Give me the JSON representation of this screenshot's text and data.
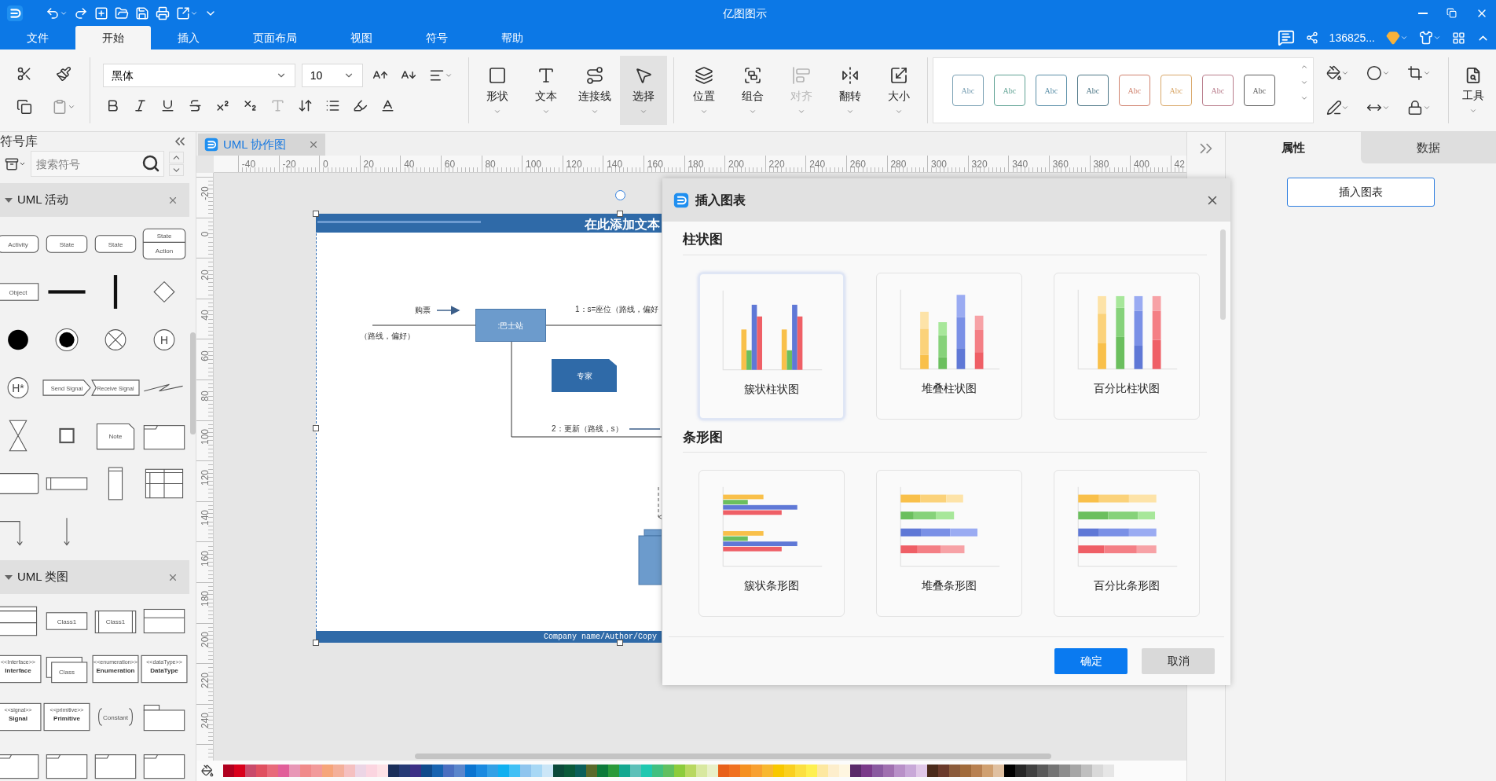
{
  "app": {
    "title": "亿图图示",
    "user": "136825..."
  },
  "menu": [
    {
      "label": "文件",
      "selected": false
    },
    {
      "label": "开始",
      "selected": true
    },
    {
      "label": "插入",
      "selected": false
    },
    {
      "label": "页面布局",
      "selected": false
    },
    {
      "label": "视图",
      "selected": false
    },
    {
      "label": "符号",
      "selected": false
    },
    {
      "label": "帮助",
      "selected": false
    }
  ],
  "ribbon": {
    "font": "黑体",
    "font_size": "10",
    "format_buttons": [
      {
        "kind": "bold",
        "disabled": false
      },
      {
        "kind": "italic",
        "disabled": false
      },
      {
        "kind": "underline",
        "disabled": false
      },
      {
        "kind": "strike",
        "disabled": false
      },
      {
        "kind": "superscript",
        "disabled": false
      },
      {
        "kind": "subscript",
        "disabled": false
      },
      {
        "kind": "text-style",
        "disabled": true
      },
      {
        "kind": "line-spacing",
        "disabled": false
      },
      {
        "kind": "list",
        "disabled": false
      },
      {
        "kind": "highlight",
        "disabled": false
      },
      {
        "kind": "font-color",
        "disabled": false
      }
    ],
    "tools": [
      {
        "kind": "shape",
        "label": "形状",
        "selected": false,
        "disabled": false
      },
      {
        "kind": "text",
        "label": "文本",
        "selected": false,
        "disabled": false
      },
      {
        "kind": "connector",
        "label": "连接线",
        "selected": false,
        "disabled": false
      },
      {
        "kind": "select",
        "label": "选择",
        "selected": true,
        "disabled": false
      },
      {
        "kind": "position",
        "label": "位置",
        "selected": false,
        "disabled": false
      },
      {
        "kind": "group",
        "label": "组合",
        "selected": false,
        "disabled": false
      },
      {
        "kind": "align",
        "label": "对齐",
        "selected": false,
        "disabled": true
      },
      {
        "kind": "flip",
        "label": "翻转",
        "selected": false,
        "disabled": false
      },
      {
        "kind": "size",
        "label": "大小",
        "selected": false,
        "disabled": false
      }
    ],
    "styles": [
      {
        "label": "Abc",
        "color": "#7aa0b4"
      },
      {
        "label": "Abc",
        "color": "#5fa293"
      },
      {
        "label": "Abc",
        "color": "#5a8fa8"
      },
      {
        "label": "Abc",
        "color": "#4f7888"
      },
      {
        "label": "Abc",
        "color": "#d0826e"
      },
      {
        "label": "Abc",
        "color": "#d9a86a"
      },
      {
        "label": "Abc",
        "color": "#b97d8c"
      },
      {
        "label": "Abc",
        "color": "#606060"
      }
    ],
    "tools_button": "工具"
  },
  "library": {
    "title": "符号库",
    "search": {
      "placeholder": "搜索符号"
    },
    "sections": [
      {
        "title": "UML 活动",
        "expanded": true,
        "shapes": [
          {
            "kind": "rounded",
            "label": "Activity"
          },
          {
            "kind": "rounded",
            "label": "State"
          },
          {
            "kind": "rounded",
            "label": "State"
          },
          {
            "kind": "state-action",
            "label": "State",
            "sublabel": "Action"
          },
          {
            "kind": "rect",
            "label": "Object"
          },
          {
            "kind": "hbar"
          },
          {
            "kind": "vbar"
          },
          {
            "kind": "diamond"
          },
          {
            "kind": "initial"
          },
          {
            "kind": "final"
          },
          {
            "kind": "flow-final"
          },
          {
            "kind": "history",
            "label": "H"
          },
          {
            "kind": "history",
            "label": "H*"
          },
          {
            "kind": "send",
            "label": "Send Signal"
          },
          {
            "kind": "receive",
            "label": "Receive Signal"
          },
          {
            "kind": "zigzag"
          },
          {
            "kind": "hourglass"
          },
          {
            "kind": "square"
          },
          {
            "kind": "note",
            "label": "Note"
          },
          {
            "kind": "frame"
          },
          {
            "kind": "rect-empty"
          },
          {
            "kind": "double-rect"
          },
          {
            "kind": "tall-rect"
          },
          {
            "kind": "grid"
          },
          {
            "kind": "elbow-arrow"
          },
          {
            "kind": "down-arrow"
          }
        ]
      },
      {
        "title": "UML 类图",
        "expanded": true,
        "shapes": [
          {
            "kind": "class-compartments"
          },
          {
            "kind": "rect",
            "label": "Class1"
          },
          {
            "kind": "class-bars",
            "label": "Class1"
          },
          {
            "kind": "interface-list"
          },
          {
            "kind": "stereotype",
            "label": "Interface",
            "sublabel": "<<Interface>>"
          },
          {
            "kind": "stacked",
            "label": "Class"
          },
          {
            "kind": "stereotype",
            "label": "Enumeration",
            "sublabel": "<<enumeration>>"
          },
          {
            "kind": "stereotype",
            "label": "DataType",
            "sublabel": "<<dataType>>"
          },
          {
            "kind": "stereotype",
            "label": "Signal",
            "sublabel": "<<signal>>"
          },
          {
            "kind": "stereotype",
            "label": "Primitive",
            "sublabel": "<<primitive>>"
          },
          {
            "kind": "constant",
            "label": "Constant"
          },
          {
            "kind": "package"
          },
          {
            "kind": "frame"
          },
          {
            "kind": "frame"
          },
          {
            "kind": "frame"
          },
          {
            "kind": "frame"
          }
        ]
      }
    ]
  },
  "document_tab": {
    "title": "UML 协作图"
  },
  "ruler": {
    "horizontal": [
      "-40",
      "-20",
      "0",
      "20",
      "40",
      "60",
      "80",
      "100",
      "120",
      "140",
      "160",
      "180",
      "200",
      "220",
      "240",
      "260",
      "280",
      "300",
      "320",
      "340",
      "360",
      "380",
      "400",
      "42"
    ],
    "vertical": [
      "-20",
      "0",
      "20",
      "40",
      "60",
      "80",
      "100",
      "120",
      "140",
      "160",
      "180",
      "200",
      "220",
      "240"
    ]
  },
  "diagram": {
    "header": "在此添加文本",
    "footer": "Company name/Author/Copy",
    "entry_label": "购票",
    "entry_params": "（路线，偏好）",
    "station": ":巴士站",
    "expert": "专家",
    "message_1": "1：s=座位（路线，偏好",
    "message_2": "2：更新（路线，s）"
  },
  "palette": [
    {
      "color": "#b0001e"
    },
    {
      "color": "#d9001b"
    },
    {
      "color": "#c94a6a"
    },
    {
      "color": "#e05060"
    },
    {
      "color": "#e86a7a"
    },
    {
      "color": "#e15f99"
    },
    {
      "color": "#e897b6"
    },
    {
      "color": "#f08a8a"
    },
    {
      "color": "#f29a9a"
    },
    {
      "color": "#f6a57a"
    },
    {
      "color": "#f4b09a"
    },
    {
      "color": "#f5c0c0"
    },
    {
      "color": "#ecd5e5"
    },
    {
      "color": "#fbd5e0"
    },
    {
      "color": "#fde2e6"
    },
    {
      "color": "#1a2f5a"
    },
    {
      "color": "#253a75"
    },
    {
      "color": "#3c2f85"
    },
    {
      "color": "#0f4a8c"
    },
    {
      "color": "#1763b0"
    },
    {
      "color": "#4a6fc0"
    },
    {
      "color": "#5a86cc"
    },
    {
      "color": "#0a74d0"
    },
    {
      "color": "#1a8ae0"
    },
    {
      "color": "#33a1e6"
    },
    {
      "color": "#10b0f0"
    },
    {
      "color": "#40c0f5"
    },
    {
      "color": "#8fc5ee"
    },
    {
      "color": "#a8d8f5"
    },
    {
      "color": "#cbe6f7"
    },
    {
      "color": "#0b4a3a"
    },
    {
      "color": "#0a5a3a"
    },
    {
      "color": "#0b5f5a"
    },
    {
      "color": "#5a6a2a"
    },
    {
      "color": "#0c7a3a"
    },
    {
      "color": "#2a9a3a"
    },
    {
      "color": "#14a890"
    },
    {
      "color": "#5cc0b8"
    },
    {
      "color": "#20c8b0"
    },
    {
      "color": "#40c080"
    },
    {
      "color": "#60c060"
    },
    {
      "color": "#8ccc3c"
    },
    {
      "color": "#b8d860"
    },
    {
      "color": "#d8e8a0"
    },
    {
      "color": "#e8f0c8"
    },
    {
      "color": "#e8601a"
    },
    {
      "color": "#f07020"
    },
    {
      "color": "#f59020"
    },
    {
      "color": "#f8a030"
    },
    {
      "color": "#f8b830"
    },
    {
      "color": "#f8c800"
    },
    {
      "color": "#fad020"
    },
    {
      "color": "#fce040"
    },
    {
      "color": "#fef050"
    },
    {
      "color": "#fde8a0"
    },
    {
      "color": "#fdeecc"
    },
    {
      "color": "#fef6e0"
    },
    {
      "color": "#5a2a6a"
    },
    {
      "color": "#7a3a8a"
    },
    {
      "color": "#8a5aa0"
    },
    {
      "color": "#a070b0"
    },
    {
      "color": "#b890c8"
    },
    {
      "color": "#c8a8d8"
    },
    {
      "color": "#e0c8e8"
    },
    {
      "color": "#4a2a1a"
    },
    {
      "color": "#6a3a2a"
    },
    {
      "color": "#8a5a3a"
    },
    {
      "color": "#a06a3a"
    },
    {
      "color": "#b88050"
    },
    {
      "color": "#d0a070"
    },
    {
      "color": "#e0c0a0"
    },
    {
      "color": "#000000"
    },
    {
      "color": "#262626"
    },
    {
      "color": "#404040"
    },
    {
      "color": "#595959"
    },
    {
      "color": "#737373"
    },
    {
      "color": "#8c8c8c"
    },
    {
      "color": "#a6a6a6"
    },
    {
      "color": "#bfbfbf"
    },
    {
      "color": "#d9d9d9"
    },
    {
      "color": "#e6e6e6"
    }
  ],
  "right_panel": {
    "tabs": [
      {
        "label": "属性",
        "selected": true
      },
      {
        "label": "数据",
        "selected": false
      }
    ],
    "button": "插入图表"
  },
  "dialog": {
    "title": "插入图表",
    "sections": [
      {
        "title": "柱状图",
        "charts": [
          {
            "kind": "clustered-column",
            "label": "簇状柱状图",
            "selected": true
          },
          {
            "kind": "stacked-column",
            "label": "堆叠柱状图",
            "selected": false
          },
          {
            "kind": "percent-column",
            "label": "百分比柱状图",
            "selected": false
          }
        ]
      },
      {
        "title": "条形图",
        "charts": [
          {
            "kind": "clustered-bar",
            "label": "簇状条形图",
            "selected": false
          },
          {
            "kind": "stacked-bar",
            "label": "堆叠条形图",
            "selected": false
          },
          {
            "kind": "percent-bar",
            "label": "百分比条形图",
            "selected": false
          }
        ]
      }
    ],
    "buttons": [
      {
        "kind": "primary",
        "label": "确定"
      },
      {
        "kind": "secondary",
        "label": "取消"
      }
    ]
  }
}
